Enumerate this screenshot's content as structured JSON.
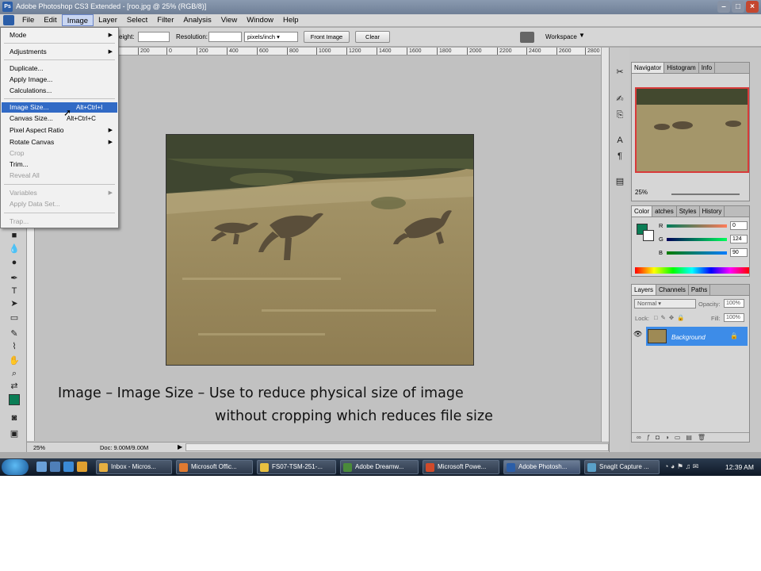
{
  "window": {
    "title": "Adobe Photoshop CS3 Extended - [roo.jpg @ 25% (RGB/8)]"
  },
  "menubar": [
    "File",
    "Edit",
    "Image",
    "Layer",
    "Select",
    "Filter",
    "Analysis",
    "View",
    "Window",
    "Help"
  ],
  "options": {
    "height_label": "eight:",
    "resolution_label": "Resolution:",
    "units": "pixels/inch",
    "front_image": "Front Image",
    "clear": "Clear",
    "workspace": "Workspace"
  },
  "image_menu": {
    "mode": "Mode",
    "adjustments": "Adjustments",
    "duplicate": "Duplicate...",
    "apply_image": "Apply Image...",
    "calculations": "Calculations...",
    "image_size": "Image Size...",
    "image_size_sc": "Alt+Ctrl+I",
    "canvas_size": "Canvas Size...",
    "canvas_size_sc": "Alt+Ctrl+C",
    "pixel_aspect": "Pixel Aspect Ratio",
    "rotate": "Rotate Canvas",
    "crop": "Crop",
    "trim": "Trim...",
    "reveal_all": "Reveal All",
    "variables": "Variables",
    "apply_data": "Apply Data Set...",
    "trap": "Trap..."
  },
  "ruler_ticks": [
    "200",
    "0",
    "200",
    "400",
    "600",
    "800",
    "1000",
    "1200",
    "1400",
    "1600",
    "1800",
    "2000",
    "2200",
    "2400",
    "2600",
    "2800"
  ],
  "status": {
    "zoom": "25%",
    "doc": "Doc: 9.00M/9.00M"
  },
  "navigator": {
    "tabs": [
      "Navigator",
      "Histogram",
      "Info"
    ],
    "zoom": "25%"
  },
  "color": {
    "tabs": [
      "Color",
      "atches",
      "Styles",
      "History"
    ],
    "r_label": "R",
    "g_label": "G",
    "b_label": "B",
    "r": "0",
    "g": "124",
    "b": "90",
    "fg_hex": "#007c5a"
  },
  "layers": {
    "tabs": [
      "Layers",
      "Channels",
      "Paths"
    ],
    "blend": "Normal",
    "opacity_label": "Opacity:",
    "opacity": "100%",
    "lock_label": "Lock:",
    "fill_label": "Fill:",
    "fill": "100%",
    "layer_name": "Background"
  },
  "caption": {
    "line1": "Image – Image Size – Use to reduce physical size of image",
    "line2": "without cropping which reduces file size"
  },
  "taskbar": {
    "items": [
      "Inbox - Micros...",
      "Microsoft Offic...",
      "FS07-TSM-251-...",
      "Adobe Dreamw...",
      "Microsoft Powe...",
      "Adobe Photosh...",
      "SnagIt Capture ..."
    ],
    "clock": "12:39 AM"
  }
}
